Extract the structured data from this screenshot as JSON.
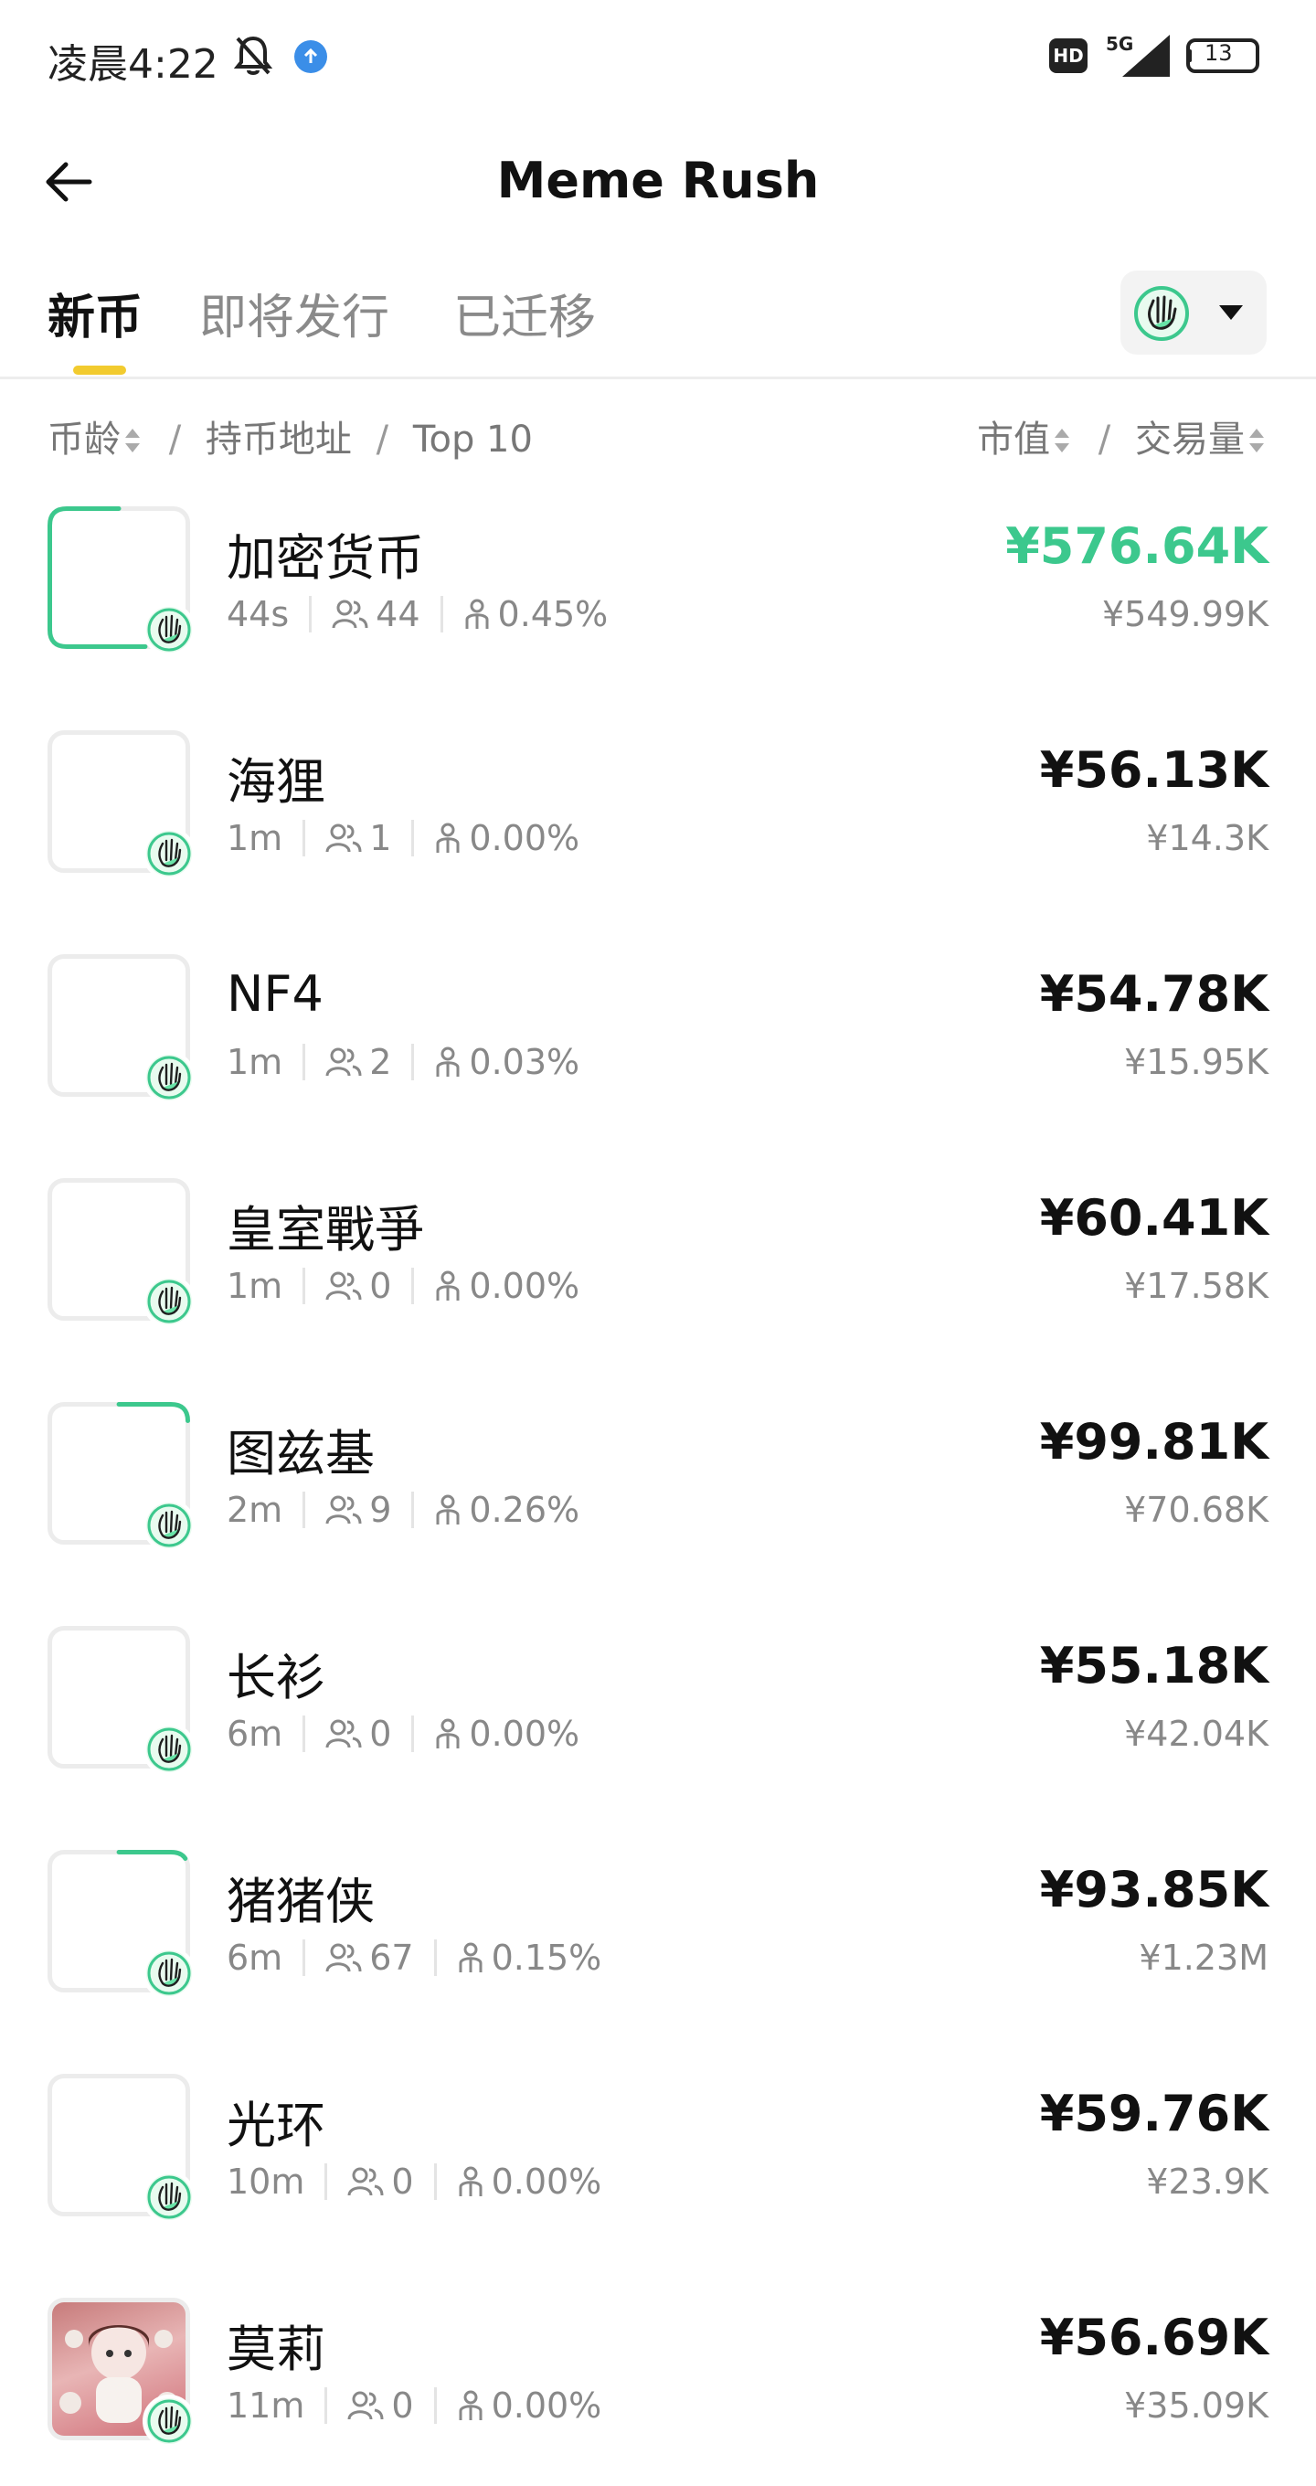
{
  "status": {
    "time": "凌晨4:22",
    "hd": "HD",
    "network": "5G",
    "battery": "13"
  },
  "header": {
    "title": "Meme Rush"
  },
  "tabs": [
    {
      "label": "新币",
      "active": true
    },
    {
      "label": "即将发行",
      "active": false
    },
    {
      "label": "已迁移",
      "active": false
    }
  ],
  "sort": {
    "age": "币龄",
    "holders": "持币地址",
    "top10": "Top 10",
    "market_cap": "市值",
    "volume": "交易量",
    "slash": "/"
  },
  "colors": {
    "accent_green": "#3cc88d",
    "tab_underline": "#f2cb2f"
  },
  "coins": [
    {
      "name": "加密货币",
      "age": "44s",
      "holders": "44",
      "top10": "0.45%",
      "market_cap": "¥576.64K",
      "volume": "¥549.99K",
      "progress": 0.55,
      "hot": true,
      "image": "none"
    },
    {
      "name": "海狸",
      "age": "1m",
      "holders": "1",
      "top10": "0.00%",
      "market_cap": "¥56.13K",
      "volume": "¥14.3K",
      "progress": 0.0,
      "hot": false,
      "image": "none"
    },
    {
      "name": "NF4",
      "age": "1m",
      "holders": "2",
      "top10": "0.03%",
      "market_cap": "¥54.78K",
      "volume": "¥15.95K",
      "progress": 0.0,
      "hot": false,
      "image": "none"
    },
    {
      "name": "皇室戰爭",
      "age": "1m",
      "holders": "0",
      "top10": "0.00%",
      "market_cap": "¥60.41K",
      "volume": "¥17.58K",
      "progress": 0.0,
      "hot": false,
      "image": "none"
    },
    {
      "name": "图兹基",
      "age": "2m",
      "holders": "9",
      "top10": "0.26%",
      "market_cap": "¥99.81K",
      "volume": "¥70.68K",
      "progress": 0.15,
      "hot": false,
      "image": "none"
    },
    {
      "name": "长衫",
      "age": "6m",
      "holders": "0",
      "top10": "0.00%",
      "market_cap": "¥55.18K",
      "volume": "¥42.04K",
      "progress": 0.0,
      "hot": false,
      "image": "none"
    },
    {
      "name": "猪猪侠",
      "age": "6m",
      "holders": "67",
      "top10": "0.15%",
      "market_cap": "¥93.85K",
      "volume": "¥1.23M",
      "progress": 0.13,
      "hot": false,
      "image": "none"
    },
    {
      "name": "光环",
      "age": "10m",
      "holders": "0",
      "top10": "0.00%",
      "market_cap": "¥59.76K",
      "volume": "¥23.9K",
      "progress": 0.0,
      "hot": false,
      "image": "none"
    },
    {
      "name": "莫莉",
      "age": "11m",
      "holders": "0",
      "top10": "0.00%",
      "market_cap": "¥56.69K",
      "volume": "¥35.09K",
      "progress": 0.0,
      "hot": false,
      "image": "doll-picture"
    }
  ]
}
